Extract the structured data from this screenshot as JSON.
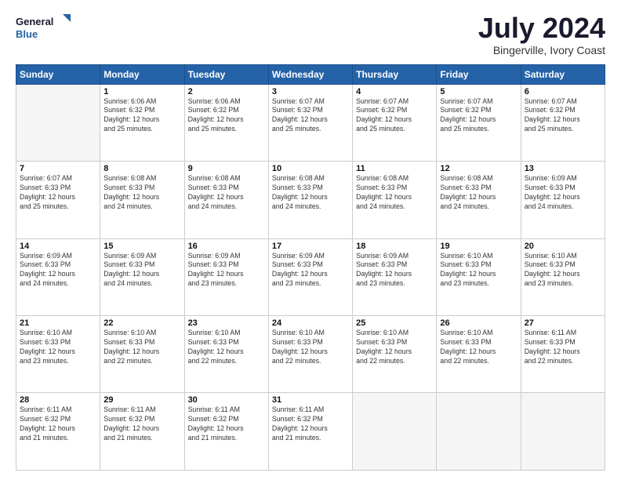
{
  "logo": {
    "line1": "General",
    "line2": "Blue"
  },
  "title": "July 2024",
  "subtitle": "Bingerville, Ivory Coast",
  "days_header": [
    "Sunday",
    "Monday",
    "Tuesday",
    "Wednesday",
    "Thursday",
    "Friday",
    "Saturday"
  ],
  "weeks": [
    [
      {
        "day": "",
        "detail": ""
      },
      {
        "day": "1",
        "detail": "Sunrise: 6:06 AM\nSunset: 6:32 PM\nDaylight: 12 hours\nand 25 minutes."
      },
      {
        "day": "2",
        "detail": "Sunrise: 6:06 AM\nSunset: 6:32 PM\nDaylight: 12 hours\nand 25 minutes."
      },
      {
        "day": "3",
        "detail": "Sunrise: 6:07 AM\nSunset: 6:32 PM\nDaylight: 12 hours\nand 25 minutes."
      },
      {
        "day": "4",
        "detail": "Sunrise: 6:07 AM\nSunset: 6:32 PM\nDaylight: 12 hours\nand 25 minutes."
      },
      {
        "day": "5",
        "detail": "Sunrise: 6:07 AM\nSunset: 6:32 PM\nDaylight: 12 hours\nand 25 minutes."
      },
      {
        "day": "6",
        "detail": "Sunrise: 6:07 AM\nSunset: 6:32 PM\nDaylight: 12 hours\nand 25 minutes."
      }
    ],
    [
      {
        "day": "7",
        "detail": "Sunrise: 6:07 AM\nSunset: 6:33 PM\nDaylight: 12 hours\nand 25 minutes."
      },
      {
        "day": "8",
        "detail": "Sunrise: 6:08 AM\nSunset: 6:33 PM\nDaylight: 12 hours\nand 24 minutes."
      },
      {
        "day": "9",
        "detail": "Sunrise: 6:08 AM\nSunset: 6:33 PM\nDaylight: 12 hours\nand 24 minutes."
      },
      {
        "day": "10",
        "detail": "Sunrise: 6:08 AM\nSunset: 6:33 PM\nDaylight: 12 hours\nand 24 minutes."
      },
      {
        "day": "11",
        "detail": "Sunrise: 6:08 AM\nSunset: 6:33 PM\nDaylight: 12 hours\nand 24 minutes."
      },
      {
        "day": "12",
        "detail": "Sunrise: 6:08 AM\nSunset: 6:33 PM\nDaylight: 12 hours\nand 24 minutes."
      },
      {
        "day": "13",
        "detail": "Sunrise: 6:09 AM\nSunset: 6:33 PM\nDaylight: 12 hours\nand 24 minutes."
      }
    ],
    [
      {
        "day": "14",
        "detail": "Sunrise: 6:09 AM\nSunset: 6:33 PM\nDaylight: 12 hours\nand 24 minutes."
      },
      {
        "day": "15",
        "detail": "Sunrise: 6:09 AM\nSunset: 6:33 PM\nDaylight: 12 hours\nand 24 minutes."
      },
      {
        "day": "16",
        "detail": "Sunrise: 6:09 AM\nSunset: 6:33 PM\nDaylight: 12 hours\nand 23 minutes."
      },
      {
        "day": "17",
        "detail": "Sunrise: 6:09 AM\nSunset: 6:33 PM\nDaylight: 12 hours\nand 23 minutes."
      },
      {
        "day": "18",
        "detail": "Sunrise: 6:09 AM\nSunset: 6:33 PM\nDaylight: 12 hours\nand 23 minutes."
      },
      {
        "day": "19",
        "detail": "Sunrise: 6:10 AM\nSunset: 6:33 PM\nDaylight: 12 hours\nand 23 minutes."
      },
      {
        "day": "20",
        "detail": "Sunrise: 6:10 AM\nSunset: 6:33 PM\nDaylight: 12 hours\nand 23 minutes."
      }
    ],
    [
      {
        "day": "21",
        "detail": "Sunrise: 6:10 AM\nSunset: 6:33 PM\nDaylight: 12 hours\nand 23 minutes."
      },
      {
        "day": "22",
        "detail": "Sunrise: 6:10 AM\nSunset: 6:33 PM\nDaylight: 12 hours\nand 22 minutes."
      },
      {
        "day": "23",
        "detail": "Sunrise: 6:10 AM\nSunset: 6:33 PM\nDaylight: 12 hours\nand 22 minutes."
      },
      {
        "day": "24",
        "detail": "Sunrise: 6:10 AM\nSunset: 6:33 PM\nDaylight: 12 hours\nand 22 minutes."
      },
      {
        "day": "25",
        "detail": "Sunrise: 6:10 AM\nSunset: 6:33 PM\nDaylight: 12 hours\nand 22 minutes."
      },
      {
        "day": "26",
        "detail": "Sunrise: 6:10 AM\nSunset: 6:33 PM\nDaylight: 12 hours\nand 22 minutes."
      },
      {
        "day": "27",
        "detail": "Sunrise: 6:11 AM\nSunset: 6:33 PM\nDaylight: 12 hours\nand 22 minutes."
      }
    ],
    [
      {
        "day": "28",
        "detail": "Sunrise: 6:11 AM\nSunset: 6:32 PM\nDaylight: 12 hours\nand 21 minutes."
      },
      {
        "day": "29",
        "detail": "Sunrise: 6:11 AM\nSunset: 6:32 PM\nDaylight: 12 hours\nand 21 minutes."
      },
      {
        "day": "30",
        "detail": "Sunrise: 6:11 AM\nSunset: 6:32 PM\nDaylight: 12 hours\nand 21 minutes."
      },
      {
        "day": "31",
        "detail": "Sunrise: 6:11 AM\nSunset: 6:32 PM\nDaylight: 12 hours\nand 21 minutes."
      },
      {
        "day": "",
        "detail": ""
      },
      {
        "day": "",
        "detail": ""
      },
      {
        "day": "",
        "detail": ""
      }
    ]
  ]
}
